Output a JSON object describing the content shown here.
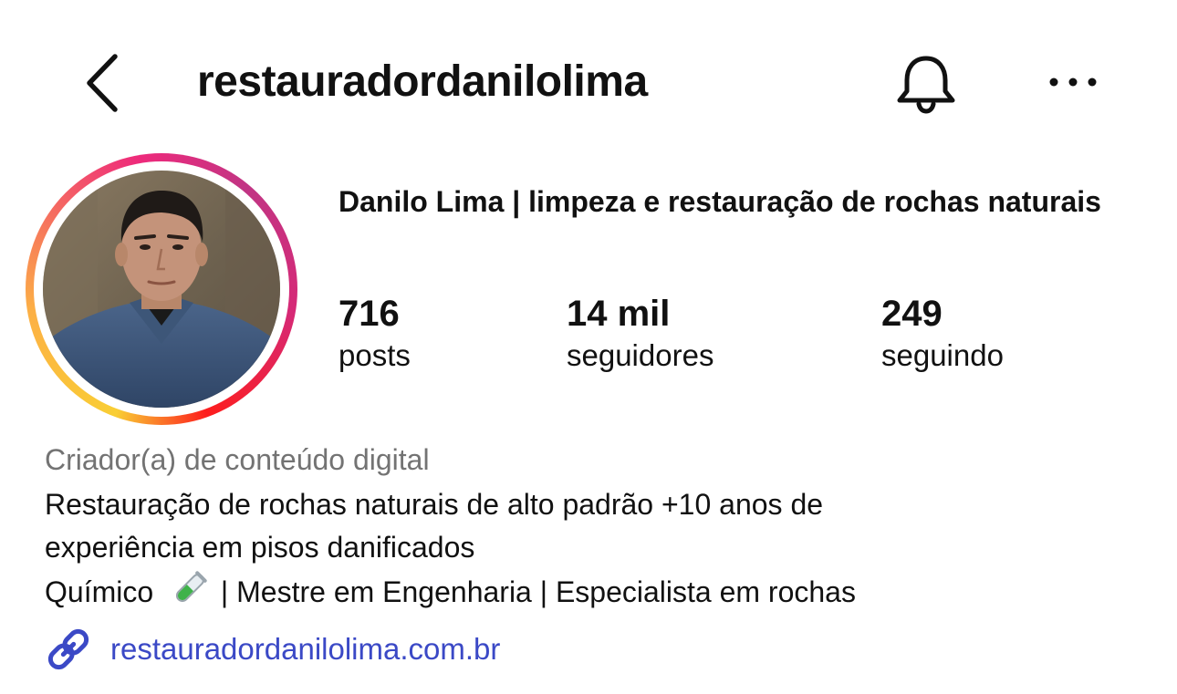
{
  "header": {
    "username": "restauradordanilolima",
    "back_icon": "chevron-left-icon",
    "bell_icon": "bell-icon",
    "more_icon": "more-horizontal-icon"
  },
  "profile": {
    "display_name": "Danilo Lima | limpeza e restauração de rochas naturais",
    "stats": {
      "posts": {
        "value": "716",
        "label": "posts"
      },
      "followers": {
        "value": "14 mil",
        "label": "seguidores"
      },
      "following": {
        "value": "249",
        "label": "seguindo"
      }
    },
    "category": "Criador(a) de conteúdo digital",
    "bio": {
      "line1": "Restauração de rochas naturais de alto padrão +10 anos de",
      "line2": "experiência em pisos danificados",
      "line3_before": "Químico",
      "line3_emoji": "test-tube-icon",
      "line3_after": "| Mestre em Engenharia | Especialista em rochas"
    },
    "link": {
      "icon": "link-icon",
      "text": "restauradordanilolima.com.br"
    }
  },
  "colors": {
    "link": "#3b49c6",
    "category": "#737373",
    "text": "#111111"
  }
}
